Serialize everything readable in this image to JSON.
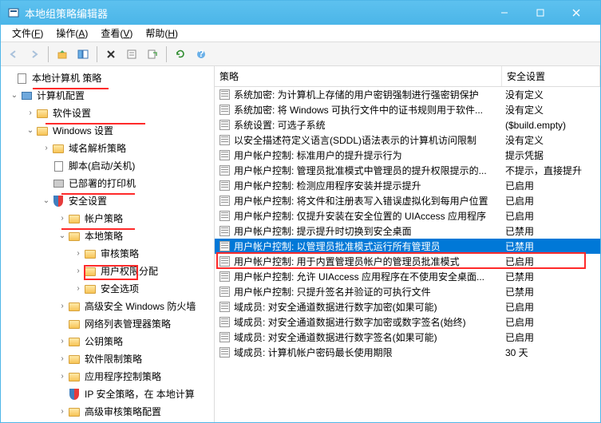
{
  "window": {
    "title": "本地组策略编辑器"
  },
  "menu": {
    "file": "文件(F)",
    "action": "操作(A)",
    "view": "查看(V)",
    "help": "帮助(H)"
  },
  "tree": {
    "root": "本地计算机 策略",
    "computer_config": "计算机配置",
    "software_settings": "软件设置",
    "windows_settings": "Windows 设置",
    "dns_policy": "域名解析策略",
    "scripts": "脚本(启动/关机)",
    "deployed_printers": "已部署的打印机",
    "security_settings": "安全设置",
    "account_policies": "帐户策略",
    "local_policies": "本地策略",
    "audit_policy": "审核策略",
    "user_rights": "用户权限分配",
    "security_options": "安全选项",
    "advanced_firewall": "高级安全 Windows 防火墙",
    "network_list": "网络列表管理器策略",
    "public_key": "公钥策略",
    "software_restriction": "软件限制策略",
    "app_control": "应用程序控制策略",
    "ip_security": "IP 安全策略，在 本地计算",
    "advanced_audit": "高级审核策略配置"
  },
  "list": {
    "col_policy": "策略",
    "col_setting": "安全设置",
    "rows": [
      {
        "p": "系统加密: 为计算机上存储的用户密钥强制进行强密钥保护",
        "s": "没有定义"
      },
      {
        "p": "系统加密: 将 Windows 可执行文件中的证书规则用于软件...",
        "s": "没有定义"
      },
      {
        "p": "系统设置: 可选子系统",
        "s": "($build.empty)"
      },
      {
        "p": "以安全描述符定义语言(SDDL)语法表示的计算机访问限制",
        "s": "没有定义"
      },
      {
        "p": "用户帐户控制: 标准用户的提升提示行为",
        "s": "提示凭据"
      },
      {
        "p": "用户帐户控制: 管理员批准模式中管理员的提升权限提示的...",
        "s": "不提示，直接提升"
      },
      {
        "p": "用户帐户控制: 检测应用程序安装并提示提升",
        "s": "已启用"
      },
      {
        "p": "用户帐户控制: 将文件和注册表写入错误虚拟化到每用户位置",
        "s": "已启用"
      },
      {
        "p": "用户帐户控制: 仅提升安装在安全位置的 UIAccess 应用程序",
        "s": "已启用"
      },
      {
        "p": "用户帐户控制: 提示提升时切换到安全桌面",
        "s": "已禁用"
      },
      {
        "p": "用户帐户控制: 以管理员批准模式运行所有管理员",
        "s": "已禁用",
        "selected": true
      },
      {
        "p": "用户帐户控制: 用于内置管理员帐户的管理员批准模式",
        "s": "已启用"
      },
      {
        "p": "用户帐户控制: 允许 UIAccess 应用程序在不使用安全桌面...",
        "s": "已禁用"
      },
      {
        "p": "用户帐户控制: 只提升签名并验证的可执行文件",
        "s": "已禁用"
      },
      {
        "p": "域成员: 对安全通道数据进行数字加密(如果可能)",
        "s": "已启用"
      },
      {
        "p": "域成员: 对安全通道数据进行数字加密或数字签名(始终)",
        "s": "已启用"
      },
      {
        "p": "域成员: 对安全通道数据进行数字签名(如果可能)",
        "s": "已启用"
      },
      {
        "p": "域成员: 计算机帐户密码最长使用期限",
        "s": "30 天"
      }
    ]
  }
}
